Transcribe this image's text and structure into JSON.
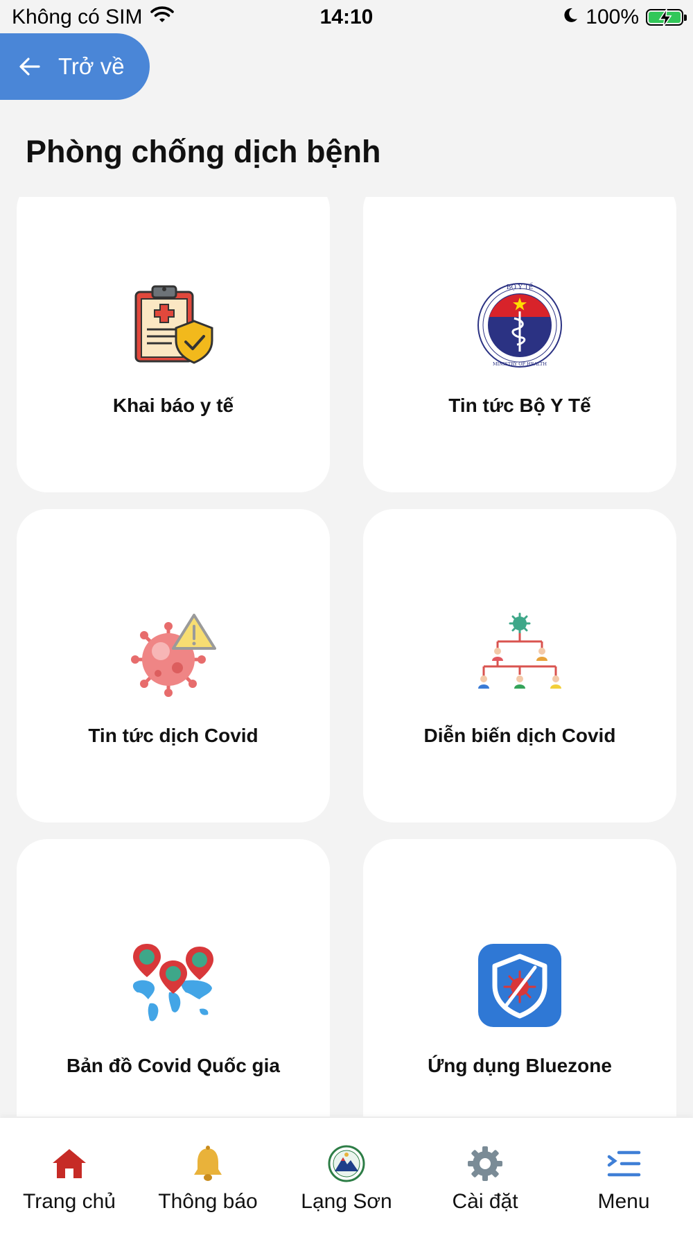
{
  "status_bar": {
    "carrier": "Không có SIM",
    "time": "14:10",
    "battery": "100%"
  },
  "header": {
    "back_label": "Trở về",
    "title": "Phòng chống dịch bệnh"
  },
  "cards": [
    {
      "label": "Khai báo y tế",
      "icon": "medical-declaration-icon"
    },
    {
      "label": "Tin tức Bộ Y Tế",
      "icon": "ministry-of-health-logo",
      "logo_text_top": "BỘ Y TẾ",
      "logo_text_bottom": "MINISTRY OF HEALTH"
    },
    {
      "label": "Tin tức dịch Covid",
      "icon": "covid-warning-icon"
    },
    {
      "label": "Diễn biến dịch Covid",
      "icon": "covid-spread-tree-icon"
    },
    {
      "label": "Bản đồ Covid Quốc gia",
      "icon": "covid-map-icon"
    },
    {
      "label": "Ứng dụng Bluezone",
      "icon": "bluezone-shield-icon"
    }
  ],
  "tabbar": {
    "items": [
      {
        "label": "Trang chủ",
        "icon": "home-icon",
        "color": "#c62b26"
      },
      {
        "label": "Thông báo",
        "icon": "bell-icon",
        "color": "#e9b23a"
      },
      {
        "label": "Lạng Sơn",
        "icon": "lang-son-emblem-icon"
      },
      {
        "label": "Cài đặt",
        "icon": "gear-icon",
        "color": "#7a8b96"
      },
      {
        "label": "Menu",
        "icon": "menu-icon",
        "color": "#3f7fd6"
      }
    ]
  },
  "colors": {
    "accent": "#4a86d7",
    "background": "#f3f3f3",
    "card": "#ffffff"
  }
}
